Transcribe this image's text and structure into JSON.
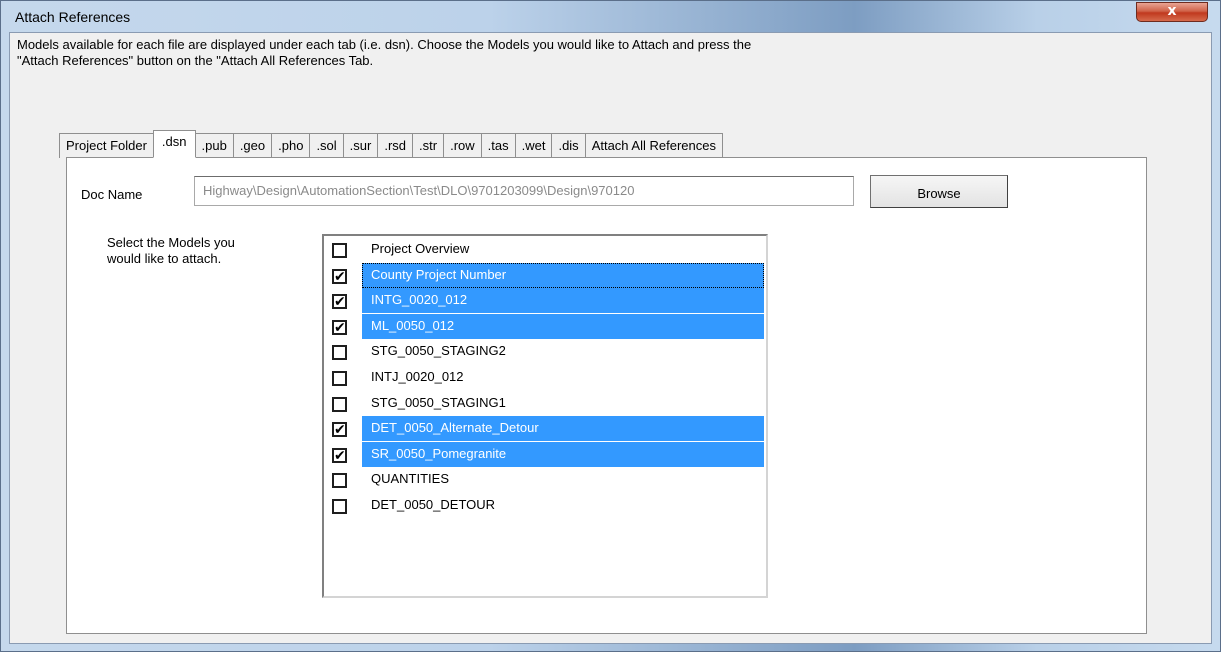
{
  "window": {
    "title": "Attach References",
    "close_label": "x"
  },
  "instructions": {
    "line1": "Models available for each file are displayed under each tab (i.e. dsn).  Choose the Models you would like to Attach and press the",
    "line2": "\"Attach References\" button on the \"Attach All References Tab."
  },
  "tabs": [
    {
      "label": "Project Folder",
      "active": false
    },
    {
      "label": ".dsn",
      "active": true
    },
    {
      "label": ".pub",
      "active": false
    },
    {
      "label": ".geo",
      "active": false
    },
    {
      "label": ".pho",
      "active": false
    },
    {
      "label": ".sol",
      "active": false
    },
    {
      "label": ".sur",
      "active": false
    },
    {
      "label": ".rsd",
      "active": false
    },
    {
      "label": ".str",
      "active": false
    },
    {
      "label": ".row",
      "active": false
    },
    {
      "label": ".tas",
      "active": false
    },
    {
      "label": ".wet",
      "active": false
    },
    {
      "label": ".dis",
      "active": false
    },
    {
      "label": "Attach All References",
      "active": false
    }
  ],
  "doc": {
    "label": "Doc Name",
    "value": "Highway\\Design\\AutomationSection\\Test\\DLO\\9701203099\\Design\\970120",
    "browse_label": "Browse"
  },
  "models": {
    "prompt_line1": "Select the Models you",
    "prompt_line2": "would like to attach.",
    "items": [
      {
        "label": "Project Overview",
        "checked": false,
        "selected": false
      },
      {
        "label": "County Project Number",
        "checked": true,
        "selected": true,
        "focused": true
      },
      {
        "label": "INTG_0020_012",
        "checked": true,
        "selected": true
      },
      {
        "label": "ML_0050_012",
        "checked": true,
        "selected": true
      },
      {
        "label": "STG_0050_STAGING2",
        "checked": false,
        "selected": false
      },
      {
        "label": "INTJ_0020_012",
        "checked": false,
        "selected": false
      },
      {
        "label": "STG_0050_STAGING1",
        "checked": false,
        "selected": false
      },
      {
        "label": "DET_0050_Alternate_Detour",
        "checked": true,
        "selected": true
      },
      {
        "label": "SR_0050_Pomegranite",
        "checked": true,
        "selected": true
      },
      {
        "label": "QUANTITIES",
        "checked": false,
        "selected": false
      },
      {
        "label": "DET_0050_DETOUR",
        "checked": false,
        "selected": false
      }
    ],
    "check_glyph": "✔"
  },
  "colors": {
    "selection": "#3399ff",
    "close_button": "#c7452a"
  }
}
